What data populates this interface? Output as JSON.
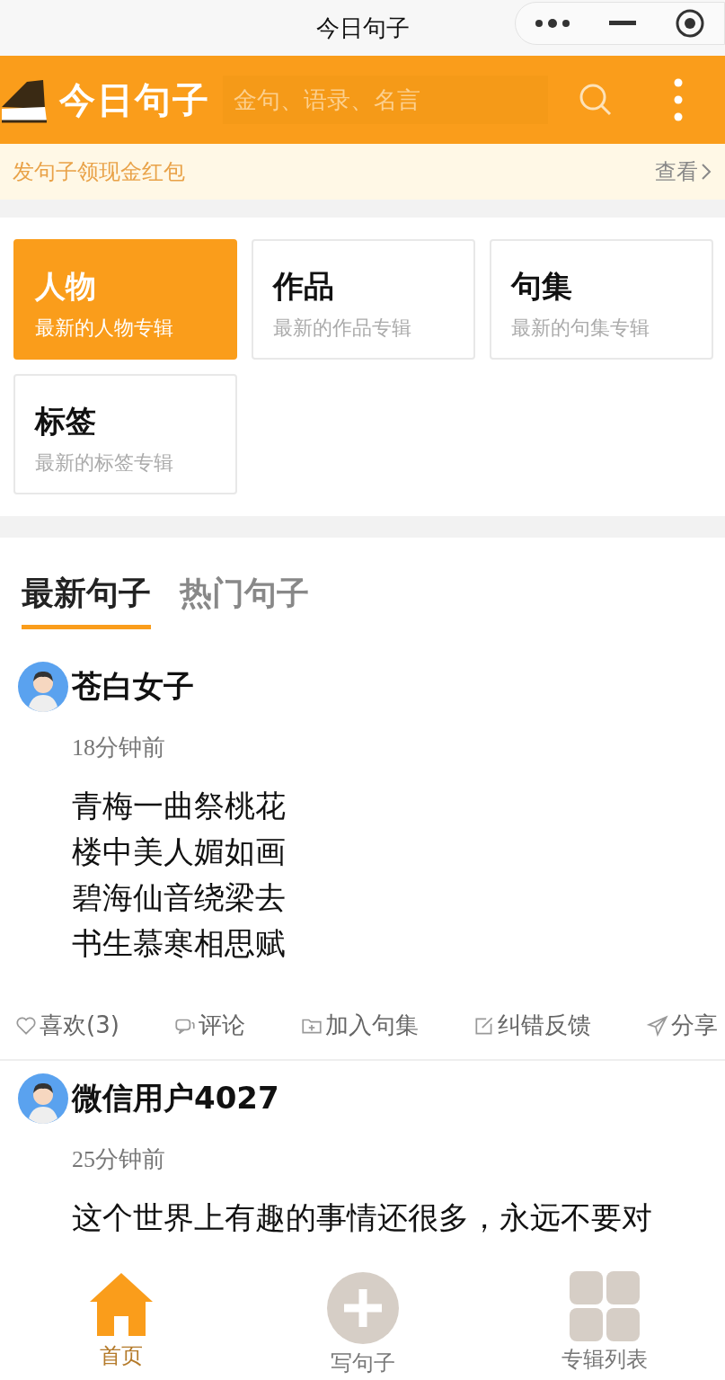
{
  "window": {
    "title": "今日句子"
  },
  "header": {
    "logo": "今日句子",
    "search": {
      "placeholder": "金句、语录、名言"
    }
  },
  "banner": {
    "text": "发句子领现金红包",
    "link": "查看"
  },
  "categories": [
    {
      "title": "人物",
      "subtitle": "最新的人物专辑",
      "selected": true
    },
    {
      "title": "作品",
      "subtitle": "最新的作品专辑",
      "selected": false
    },
    {
      "title": "句集",
      "subtitle": "最新的句集专辑",
      "selected": false
    },
    {
      "title": "标签",
      "subtitle": "最新的标签专辑",
      "selected": false
    }
  ],
  "tabs": [
    {
      "label": "最新句子",
      "selected": true
    },
    {
      "label": "热门句子",
      "selected": false
    }
  ],
  "posts": [
    {
      "user": "苍白女子",
      "time": "18分钟前",
      "lines": [
        "青梅一曲祭桃花",
        "楼中美人媚如画",
        "碧海仙音绕梁去",
        "书生慕寒相思赋"
      ],
      "actions": [
        {
          "kind": "like",
          "label": "喜欢(3)"
        },
        {
          "kind": "comment",
          "label": "评论"
        },
        {
          "kind": "collect",
          "label": "加入句集"
        },
        {
          "kind": "report",
          "label": "纠错反馈"
        },
        {
          "kind": "share",
          "label": "分享"
        }
      ]
    },
    {
      "user": "微信用户4027",
      "time": "25分钟前",
      "lines": [
        "这个世界上有趣的事情还很多，永远不要对"
      ]
    }
  ],
  "nav": [
    {
      "kind": "home",
      "label": "首页",
      "selected": true
    },
    {
      "kind": "write",
      "label": "写句子",
      "selected": false
    },
    {
      "kind": "albums",
      "label": "专辑列表",
      "selected": false
    }
  ]
}
